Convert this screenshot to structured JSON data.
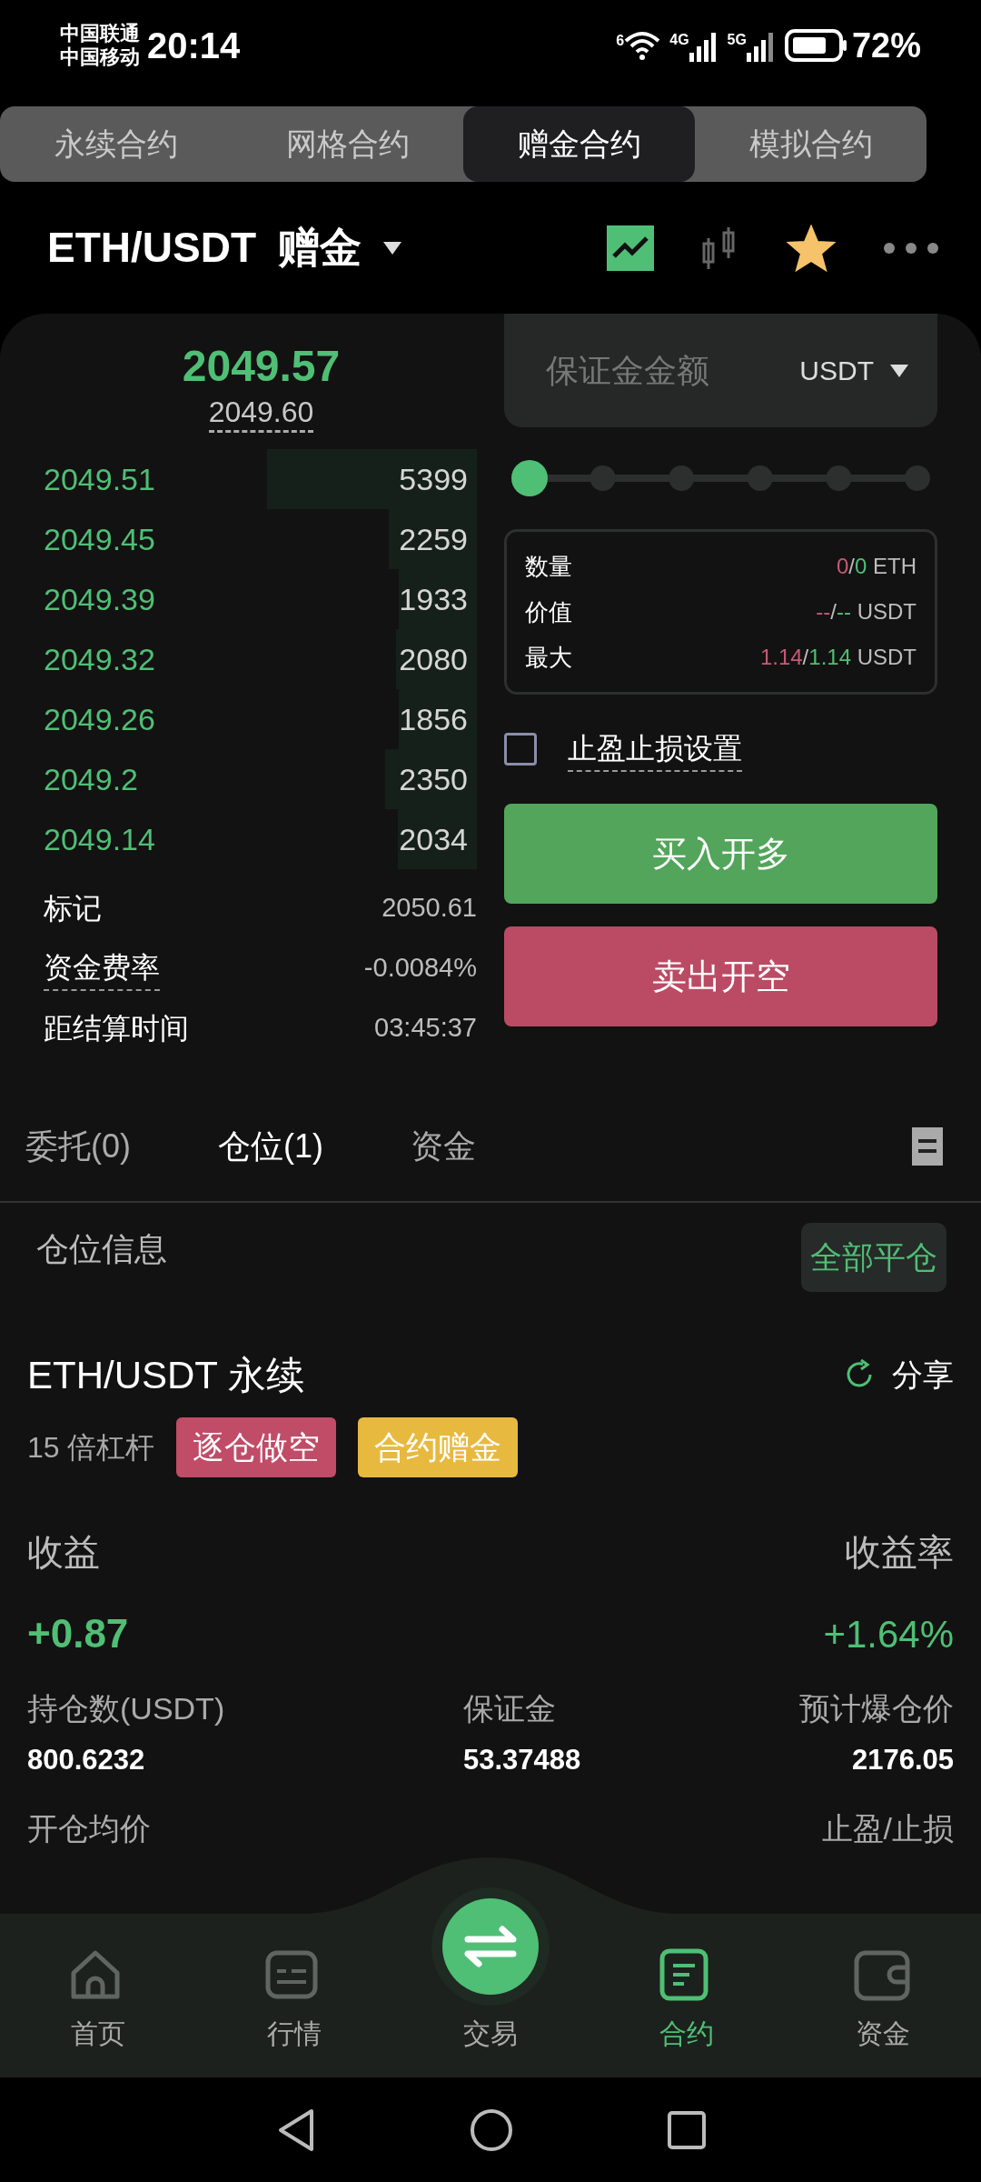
{
  "status_bar": {
    "carriers": [
      "中国联通",
      "中国移动"
    ],
    "time": "20:14",
    "wifi_badge": "6",
    "net1": "4G",
    "net2": "5G",
    "battery": "72%"
  },
  "contract_tabs": [
    {
      "label": "永续合约",
      "selected": false
    },
    {
      "label": "网格合约",
      "selected": false
    },
    {
      "label": "赠金合约",
      "selected": true
    },
    {
      "label": "模拟合约",
      "selected": false
    }
  ],
  "header": {
    "pair": "ETH/USDT",
    "mode": "赠金",
    "favorite": true
  },
  "ticker": {
    "last_price": "2049.57",
    "index_price": "2049.60"
  },
  "order_book": [
    {
      "price": "2049.51",
      "amount": "5399"
    },
    {
      "price": "2049.45",
      "amount": "2259"
    },
    {
      "price": "2049.39",
      "amount": "1933"
    },
    {
      "price": "2049.32",
      "amount": "2080"
    },
    {
      "price": "2049.26",
      "amount": "1856"
    },
    {
      "price": "2049.2",
      "amount": "2350"
    },
    {
      "price": "2049.14",
      "amount": "2034"
    }
  ],
  "market_info": [
    {
      "label": "标记",
      "value": "2050.61",
      "dashed": false
    },
    {
      "label": "资金费率",
      "value": "-0.0084%",
      "dashed": true
    },
    {
      "label": "距结算时间",
      "value": "03:45:37",
      "dashed": false
    }
  ],
  "order_form": {
    "margin_field": {
      "placeholder": "保证金金额",
      "unit": "USDT"
    },
    "leverage_slider": {
      "level": 0
    },
    "summary": [
      {
        "label": "数量",
        "parts": [
          {
            "text": "0",
            "color": "#c75a73"
          },
          {
            "text": "/",
            "color": "#bdbdbd"
          },
          {
            "text": "0",
            "color": "#4fbf75"
          },
          {
            "text": " ETH",
            "color": "#bdbdbd"
          }
        ]
      },
      {
        "label": "价值",
        "parts": [
          {
            "text": "--",
            "color": "#c75a73"
          },
          {
            "text": "/",
            "color": "#bdbdbd"
          },
          {
            "text": "--",
            "color": "#4fbf75"
          },
          {
            "text": " USDT",
            "color": "#bdbdbd"
          }
        ]
      },
      {
        "label": "最大",
        "parts": [
          {
            "text": "1.14",
            "color": "#c75a73"
          },
          {
            "text": "/",
            "color": "#bdbdbd"
          },
          {
            "text": "1.14",
            "color": "#4fbf75"
          },
          {
            "text": " USDT",
            "color": "#bdbdbd"
          }
        ]
      }
    ],
    "tp_sl": {
      "label": "止盈止损设置",
      "checked": false
    },
    "buttons": [
      {
        "label": "买入开多",
        "kind": "long"
      },
      {
        "label": "卖出开空",
        "kind": "short"
      }
    ]
  },
  "record_tabs": [
    {
      "label": "委托(0)",
      "selected": false
    },
    {
      "label": "仓位(1)",
      "selected": true
    },
    {
      "label": "资金",
      "selected": false
    }
  ],
  "positions": {
    "title": "仓位信息",
    "close_all": "全部平仓",
    "position": {
      "symbol": "ETH/USDT 永续",
      "share": "分享",
      "leverage": "15 倍杠杆",
      "tags": [
        {
          "label": "逐仓做空",
          "color": "#c04c68"
        },
        {
          "label": "合约赠金",
          "color": "#e8b93f"
        }
      ],
      "pnl_label": "收益",
      "pnl_rate_label": "收益率",
      "pnl": "+0.87",
      "pnl_rate": "+1.64%",
      "stats": [
        {
          "label": "持仓数(USDT)",
          "value": "800.6232"
        },
        {
          "label": "保证金",
          "value": "53.37488"
        },
        {
          "label": "预计爆仓价",
          "value": "2176.05"
        }
      ],
      "stats_row2": [
        "开仓均价",
        "止盈/止损"
      ]
    }
  },
  "bottom_nav": [
    {
      "label": "首页",
      "kind": "home",
      "selected": false
    },
    {
      "label": "行情",
      "kind": "market",
      "selected": false
    },
    {
      "label": "交易",
      "kind": "trade",
      "selected": false
    },
    {
      "label": "合约",
      "kind": "contract",
      "selected": true
    },
    {
      "label": "资金",
      "kind": "wallet",
      "selected": false
    }
  ]
}
